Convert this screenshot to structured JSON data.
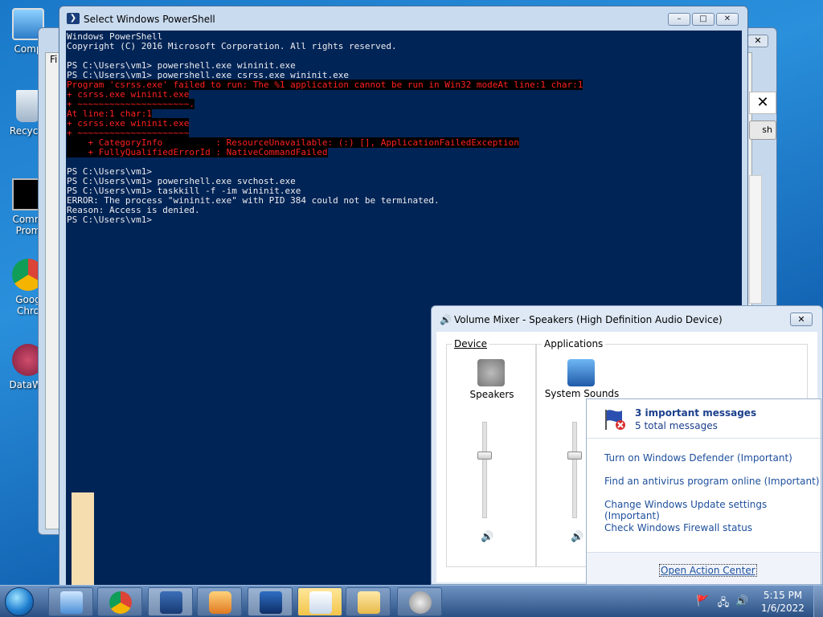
{
  "desktop": {
    "icons": [
      {
        "label": "Comp"
      },
      {
        "label": "Recycle"
      },
      {
        "label": "Comm Prom"
      },
      {
        "label": "Goog Chro"
      },
      {
        "label": "DataWa"
      }
    ]
  },
  "back_window": {
    "menu_label": "Fi",
    "close_glyph": "✕",
    "refresh_label": "sh"
  },
  "powershell": {
    "title": "Select Windows PowerShell",
    "icon_glyph": "❯",
    "controls": {
      "minimize": "–",
      "maximize": "□",
      "close": "✕"
    },
    "lines": [
      {
        "text": "Windows PowerShell",
        "type": "out"
      },
      {
        "text": "Copyright (C) 2016 Microsoft Corporation. All rights reserved.",
        "type": "out"
      },
      {
        "text": "",
        "type": "blank"
      },
      {
        "text": "PS C:\\Users\\vm1> powershell.exe wininit.exe",
        "type": "out"
      },
      {
        "text": "PS C:\\Users\\vm1> powershell.exe csrss.exe wininit.exe",
        "type": "out"
      },
      {
        "text": "Program 'csrss.exe' failed to run: The %1 application cannot be run in Win32 modeAt line:1 char:1",
        "type": "err"
      },
      {
        "text": "+ csrss.exe wininit.exe",
        "type": "err"
      },
      {
        "text": "+ ~~~~~~~~~~~~~~~~~~~~~.",
        "type": "err"
      },
      {
        "text": "At line:1 char:1",
        "type": "err"
      },
      {
        "text": "+ csrss.exe wininit.exe",
        "type": "err"
      },
      {
        "text": "+ ~~~~~~~~~~~~~~~~~~~~~",
        "type": "err"
      },
      {
        "text": "    + CategoryInfo          : ResourceUnavailable: (:) [], ApplicationFailedException",
        "type": "err"
      },
      {
        "text": "    + FullyQualifiedErrorId : NativeCommandFailed",
        "type": "err"
      },
      {
        "text": "",
        "type": "blank"
      },
      {
        "text": "PS C:\\Users\\vm1>",
        "type": "out"
      },
      {
        "text": "PS C:\\Users\\vm1> powershell.exe svchost.exe",
        "type": "out"
      },
      {
        "text": "PS C:\\Users\\vm1> taskkill -f -im wininit.exe",
        "type": "out"
      },
      {
        "text": "ERROR: The process \"wininit.exe\" with PID 384 could not be terminated.",
        "type": "out"
      },
      {
        "text": "Reason: Access is denied.",
        "type": "out"
      },
      {
        "text": "PS C:\\Users\\vm1>",
        "type": "out"
      }
    ]
  },
  "volume_mixer": {
    "title": "Volume Mixer - Speakers (High Definition Audio Device)",
    "close_glyph": "✕",
    "device_group_label": "Device",
    "applications_group_label": "Applications",
    "device_name": "Speakers",
    "app_name": "System Sounds",
    "speaker_glyph": "🔊",
    "device_level": 0.65,
    "app_level": 0.65
  },
  "action_center": {
    "title": "3 important messages",
    "subtitle": "5 total messages",
    "messages": [
      "Turn on Windows Defender (Important)",
      "Find an antivirus program online (Important)",
      "Change Windows Update settings (Important)",
      "Check Windows Firewall status"
    ],
    "open_link": "Open Action Center"
  },
  "taskbar": {
    "tray_icons": [
      "🚩",
      "🖧",
      "🔊"
    ],
    "time": "5:15 PM",
    "date": "1/6/2022"
  },
  "colors": {
    "console_bg": "#012456",
    "console_fg": "#eeedf0",
    "error_fg": "#ff2020",
    "link": "#1d4f9c"
  }
}
